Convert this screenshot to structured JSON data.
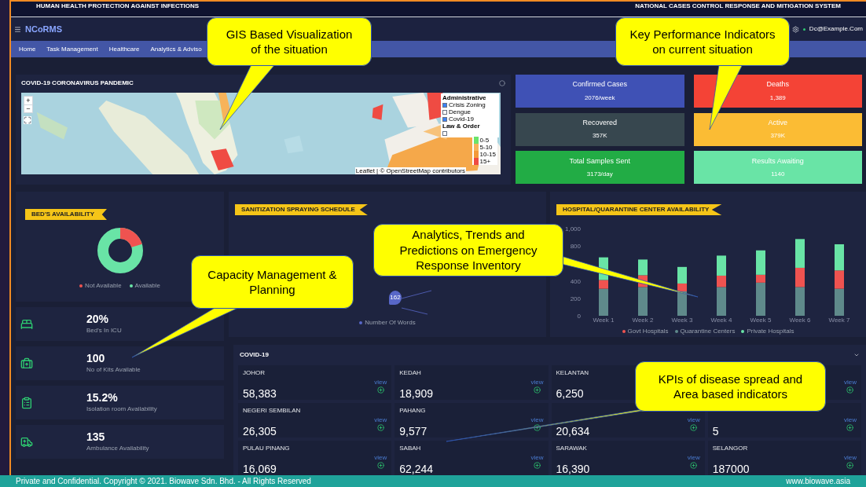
{
  "banner": {
    "left": "HUMAN HEALTH PROTECTION AGAINST INFECTIONS",
    "right": "NATIONAL CASES CONTROL RESPONSE AND MITIGATION SYSTEM"
  },
  "topbar": {
    "logo": "NCoRMS",
    "user": "Dc@Example.Com"
  },
  "menu": [
    {
      "label": "Home",
      "selected": false
    },
    {
      "label": "Task Management",
      "selected": false
    },
    {
      "label": "Healthcare",
      "selected": false
    },
    {
      "label": "Analytics & Adviso",
      "selected": false
    }
  ],
  "map_card": {
    "title": "COVID-19 CORONAVIRUS PANDEMIC",
    "zoom_in": "+",
    "zoom_out": "−",
    "layers": [
      {
        "kind": "heading",
        "label": "Administrative"
      },
      {
        "kind": "checkbox",
        "label": "Crisis Zoning",
        "checked": true
      },
      {
        "kind": "checkbox",
        "label": "Dengue",
        "checked": false
      },
      {
        "kind": "checkbox",
        "label": "Covid-19",
        "checked": true
      },
      {
        "kind": "heading",
        "label": "Law & Order"
      },
      {
        "kind": "checkbox",
        "checked": false
      }
    ],
    "scale": [
      {
        "label": "0-5",
        "color": "#6be36b"
      },
      {
        "label": "5-10",
        "color": "#f7b35a"
      },
      {
        "label": "10-15",
        "color": "#f39a3a"
      },
      {
        "label": "15+",
        "color": "#ef4b43"
      }
    ],
    "attribution": "Leaflet | © OpenStreetMap contributors"
  },
  "kpis": [
    {
      "label": "Confirmed Cases",
      "value": "2076/week",
      "color": "#3f51b5"
    },
    {
      "label": "Deaths",
      "value": "1,389",
      "color": "#f44336"
    },
    {
      "label": "Recovered",
      "value": "357K",
      "color": "#37474f"
    },
    {
      "label": "Active",
      "value": "379K",
      "color": "#fbbc34"
    },
    {
      "label": "Total Samples Sent",
      "value": "3173/day",
      "color": "#22ac45"
    },
    {
      "label": "Results Awaiting",
      "value": "1140",
      "color": "#69e4a6"
    }
  ],
  "beds": {
    "title": "BED'S AVAILABILITY",
    "legend": [
      {
        "label": "Not Available",
        "color": "#ef5350"
      },
      {
        "label": "Available",
        "color": "#69e4a6"
      }
    ]
  },
  "stats": [
    {
      "kind": "bed",
      "value": "20%",
      "label": "Bed's In ICU"
    },
    {
      "kind": "kit",
      "value": "100",
      "label": "No of Kits Available"
    },
    {
      "kind": "clipboard",
      "value": "15.2%",
      "label": "Isolation room Availability"
    },
    {
      "kind": "ambulance",
      "value": "135",
      "label": "Ambulance Availability"
    }
  ],
  "sanitization": {
    "title": "SANITIZATION SPRAYING SCHEDULE",
    "pin": "162",
    "legend": "Number Of Words"
  },
  "hospital": {
    "title": "HOSPITAL/QUARANTINE CENTER AVAILABILITY",
    "chart_data": {
      "type": "bar",
      "stacked": true,
      "categories": [
        "Week 1",
        "Week 2",
        "Week 3",
        "Week 4",
        "Week 5",
        "Week 6",
        "Week 7"
      ],
      "series": [
        {
          "name": "Govt Hospitals",
          "color": "#ef5350",
          "values": [
            100,
            135,
            90,
            130,
            90,
            220,
            210
          ]
        },
        {
          "name": "Quarantine Centers",
          "color": "#5f8a8b",
          "values": [
            310,
            330,
            280,
            330,
            380,
            330,
            310
          ]
        },
        {
          "name": "Private Hospitals",
          "color": "#69e4a6",
          "values": [
            260,
            180,
            190,
            230,
            280,
            330,
            300
          ]
        }
      ],
      "ylim": [
        0,
        1000
      ],
      "yticks": [
        0,
        200,
        400,
        800,
        {
          "value": 1000,
          "label": "1,000"
        }
      ]
    }
  },
  "covid": {
    "title": "COVID-19",
    "regions": [
      {
        "name": "JOHOR",
        "value": "58,383",
        "link": "view"
      },
      {
        "name": "KEDAH",
        "value": "18,909",
        "link": "view"
      },
      {
        "name": "KELANTAN",
        "value": "6,250"
      },
      {
        "link": "view"
      },
      {
        "name": "NEGERI SEMBILAN",
        "value": "26,305",
        "link": "view"
      },
      {
        "name": "PAHANG",
        "value": "9,577",
        "link": "view"
      },
      {
        "value": "20,634",
        "link": "view"
      },
      {
        "value": "5",
        "link": "view"
      },
      {
        "name": "PULAU PINANG",
        "value": "16,069",
        "link": "view"
      },
      {
        "name": "SABAH",
        "value": "62,244",
        "link": "view"
      },
      {
        "name": "SARAWAK",
        "value": "16,390",
        "link": "view"
      },
      {
        "name": "SELANGOR",
        "value": "187000",
        "link": "view"
      }
    ]
  },
  "callouts": [
    "GIS Based Visualization of the situation",
    "Key Performance Indicators on current situation",
    "Analytics, Trends and Predictions on Emergency Response Inventory",
    "Capacity Management & Planning",
    "KPIs of disease spread and Area based indicators"
  ],
  "footer": {
    "left": "Private and Confidential. Copyright © 2021. Biowave Sdn. Bhd. - All Rights Reserved",
    "right": "www.biowave.asia"
  }
}
